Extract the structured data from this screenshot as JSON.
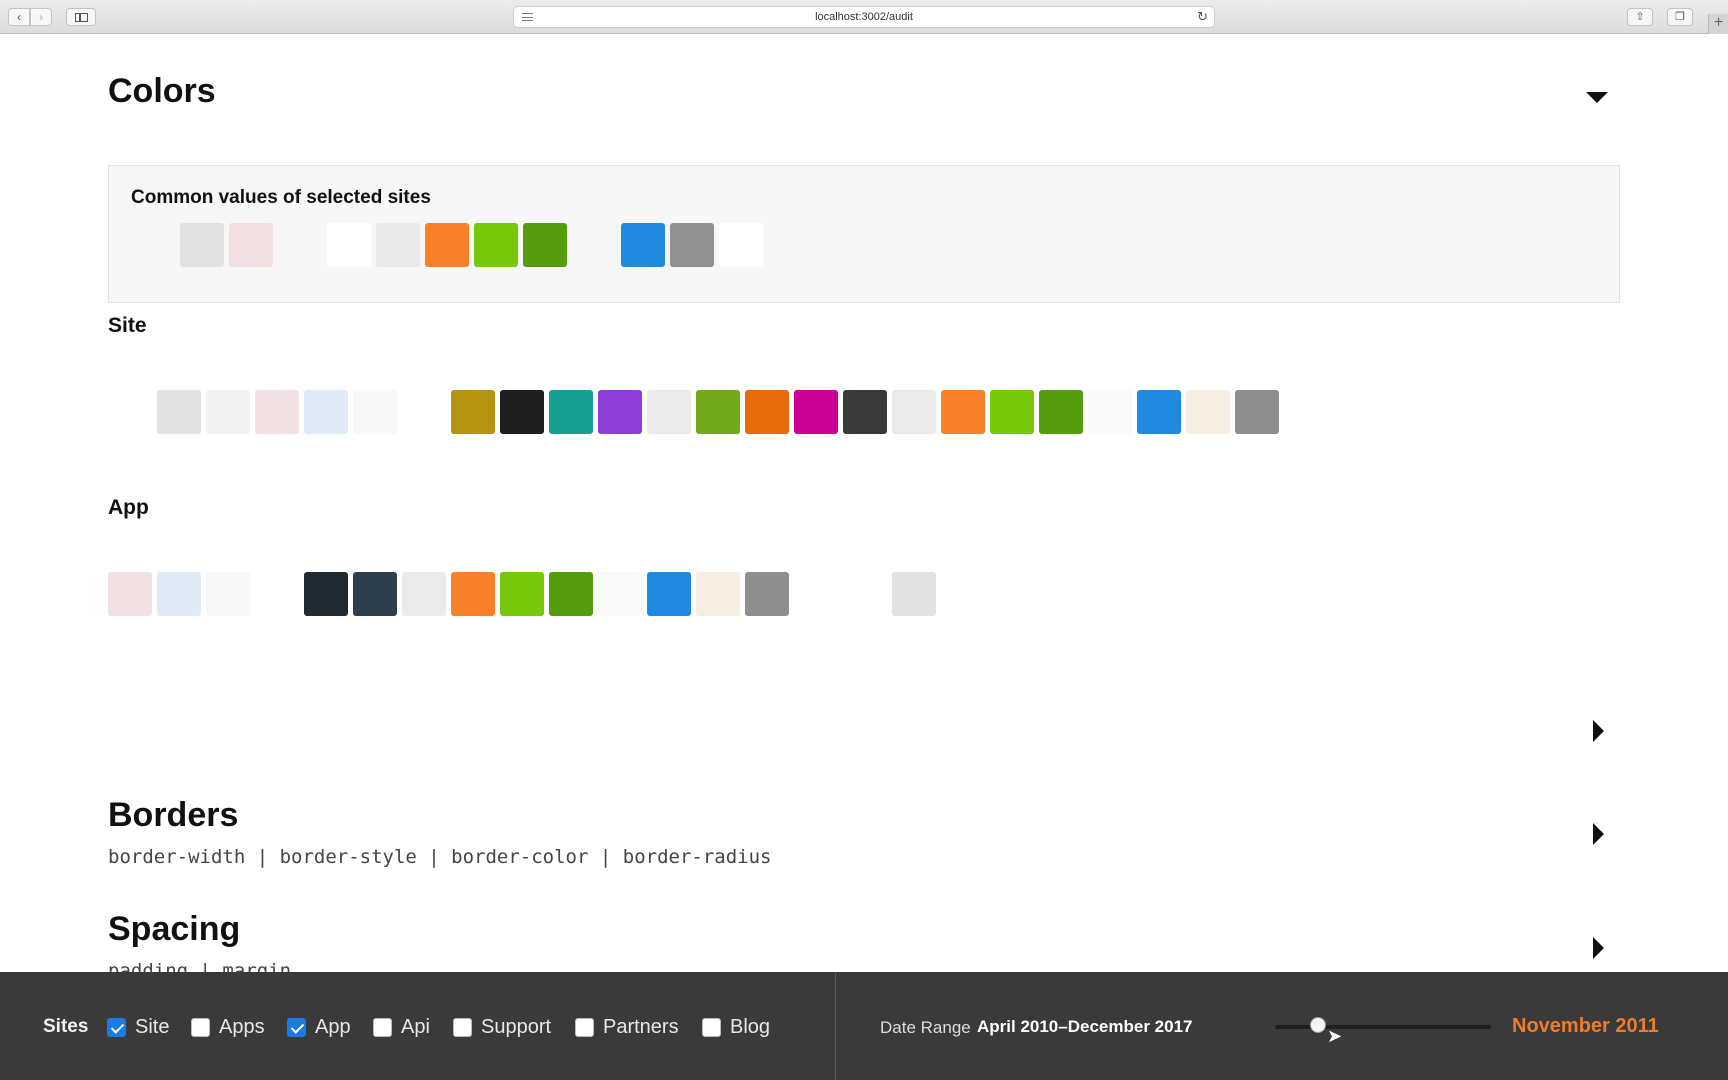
{
  "browser": {
    "url": "localhost:3002/audit"
  },
  "colors_section": {
    "title": "Colors",
    "common_label": "Common values of selected sites",
    "common_swatches": [
      "#f7f7f7",
      "#e2e2e2",
      "#f1e1e3",
      "#f7f7f7",
      "#ffffff",
      "#e9e9e9",
      "#f88029",
      "#77c80b",
      "#559d0c",
      "#f7f7f7",
      "#1f8ae0",
      "#909090",
      "#ffffff"
    ],
    "site_label": "Site",
    "site_swatches": [
      "#ffffff",
      "#e2e2e2",
      "#f3f3f3",
      "#f1e1e3",
      "#dfeaf5",
      "#f8f8f8",
      "#ffffff",
      "#b49411",
      "#1f1f1f",
      "#15a092",
      "#8e3ed8",
      "#eaeaea",
      "#72a81a",
      "#e76a0b",
      "#cc0099",
      "#3a3a3a",
      "#eaeaea",
      "#f88029",
      "#77c80b",
      "#559d0c",
      "#f9f9f9",
      "#1f8ae0",
      "#f6ede3",
      "#8e8e8e"
    ],
    "app_label": "App",
    "app_swatches": [
      "#f1e1e3",
      "#dfeaf5",
      "#f8f8f8",
      "#ffffff",
      "#1f2a33",
      "#2e3e4d",
      "#eaeaea",
      "#f88029",
      "#77c80b",
      "#559d0c",
      "#f9f9f9",
      "#1f8ae0",
      "#f6ede3",
      "#8e8e8e",
      "#ffffff",
      "#ffffff",
      "#e2e2e2"
    ]
  },
  "borders_section": {
    "title": "Borders",
    "properties": "border-width | border-style | border-color | border-radius"
  },
  "spacing_section": {
    "title": "Spacing",
    "properties": "padding | margin"
  },
  "bottom_bar": {
    "sites_label": "Sites",
    "sites": [
      {
        "label": "Site",
        "checked": true
      },
      {
        "label": "Apps",
        "checked": false
      },
      {
        "label": "App",
        "checked": true
      },
      {
        "label": "Api",
        "checked": false
      },
      {
        "label": "Support",
        "checked": false
      },
      {
        "label": "Partners",
        "checked": false
      },
      {
        "label": "Blog",
        "checked": false
      }
    ],
    "date_range_label": "Date Range",
    "date_range_value": "April 2010–December 2017",
    "slider_fraction": 0.2,
    "current_date": "November 2011",
    "accent_color": "#ef7b2d"
  }
}
